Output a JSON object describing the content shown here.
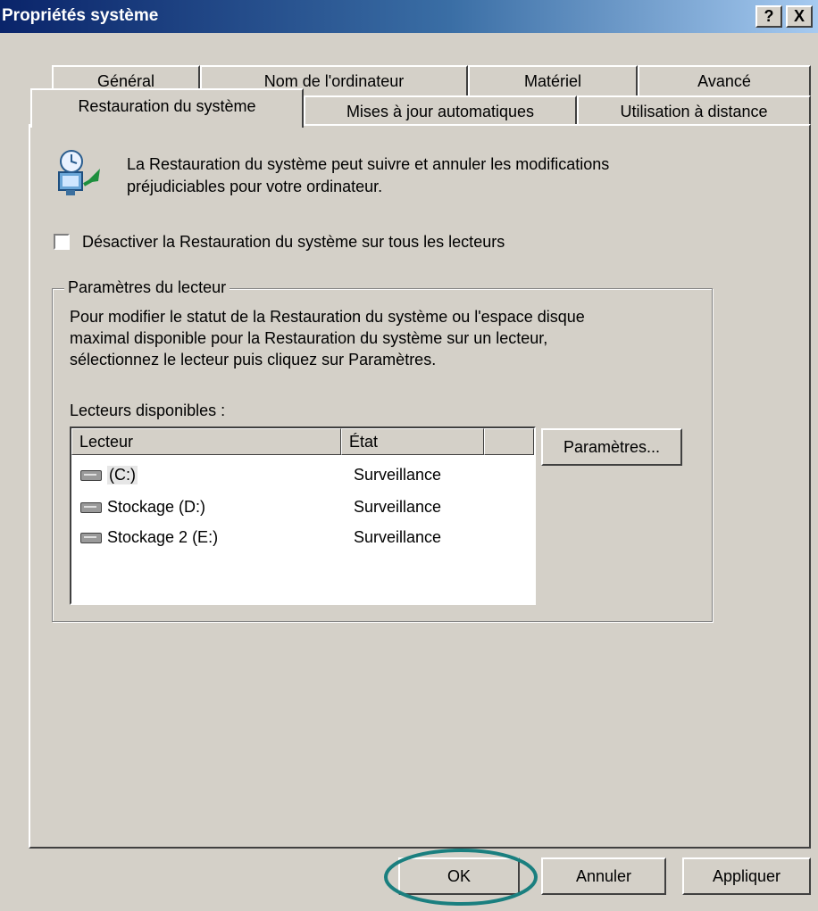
{
  "window": {
    "title": "Propriétés système",
    "help_label": "?",
    "close_label": "X"
  },
  "tabs": {
    "row1": [
      "Général",
      "Nom de l'ordinateur",
      "Matériel",
      "Avancé"
    ],
    "row2": [
      "Restauration du système",
      "Mises à jour automatiques",
      "Utilisation à distance"
    ],
    "selected": "Restauration du système"
  },
  "content": {
    "intro": "La Restauration du système peut suivre et annuler les modifications",
    "intro2": "préjudiciables pour votre ordinateur.",
    "disable_checkbox_label": "Désactiver la Restauration du système sur tous les lecteurs",
    "disable_checked": false,
    "group_title": "Paramètres du lecteur",
    "group_text1": "Pour modifier le statut de la Restauration du système ou l'espace disque",
    "group_text2": "maximal disponible pour la Restauration du système sur un lecteur,",
    "group_text3": "sélectionnez le lecteur puis cliquez sur Paramètres.",
    "drives_label": "Lecteurs disponibles :",
    "settings_button": "Paramètres..."
  },
  "drives": {
    "columns": [
      "Lecteur",
      "État"
    ],
    "rows": [
      {
        "name": "(C:)",
        "status": "Surveillance"
      },
      {
        "name": "Stockage (D:)",
        "status": "Surveillance"
      },
      {
        "name": "Stockage 2 (E:)",
        "status": "Surveillance"
      }
    ]
  },
  "footer": {
    "ok": "OK",
    "cancel": "Annuler",
    "apply": "Appliquer"
  },
  "colors": {
    "face": "#d4d0c8",
    "title_start": "#0a246a",
    "title_end": "#a6caf0",
    "highlight_circle": "#1a7f7f"
  }
}
